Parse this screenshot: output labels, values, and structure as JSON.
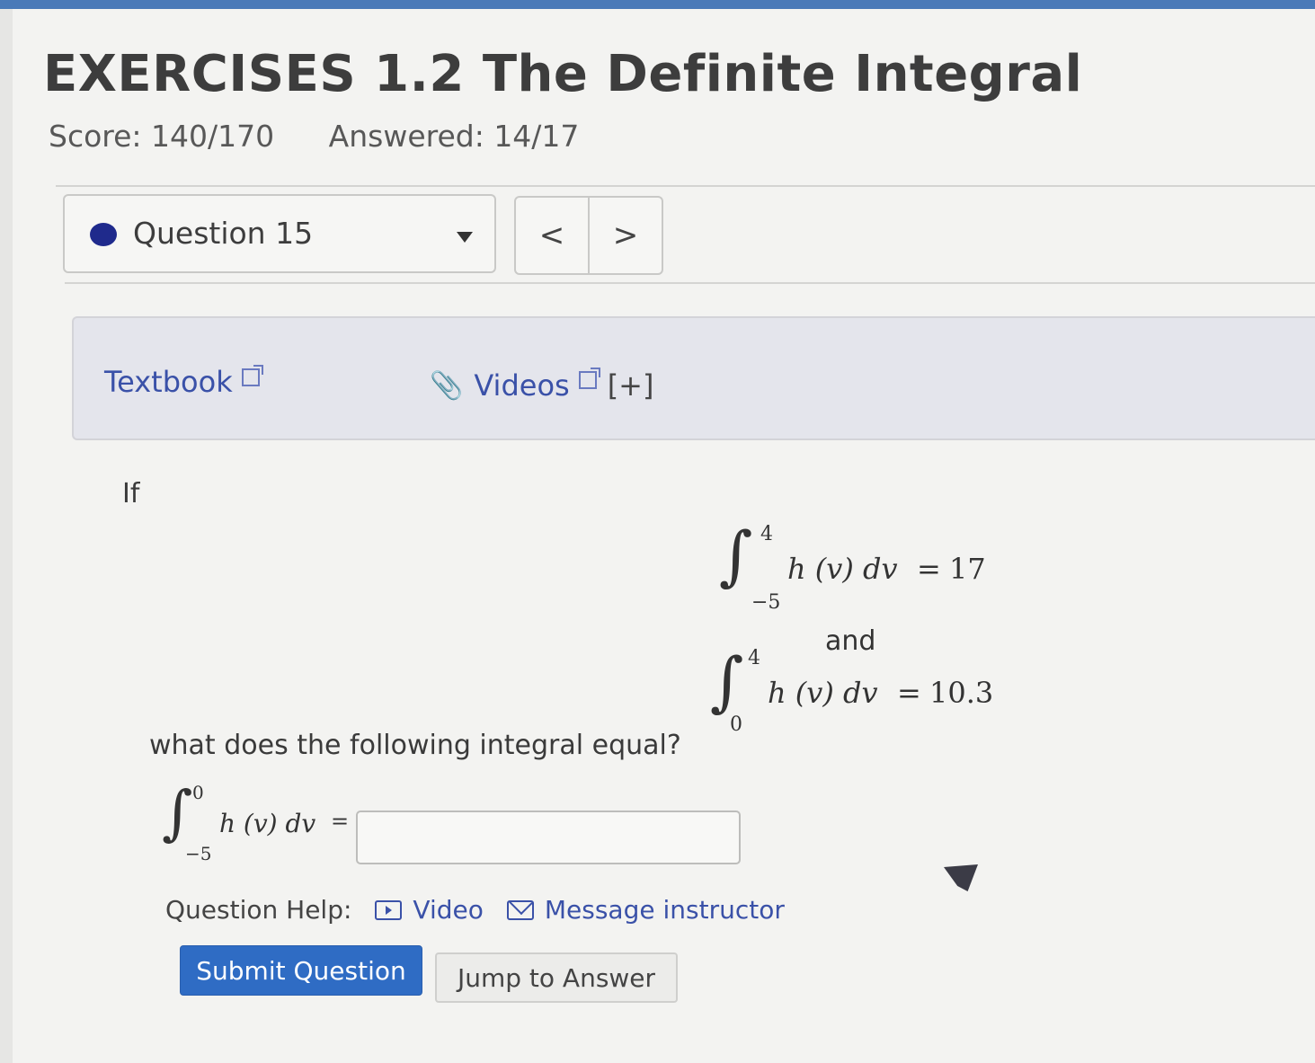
{
  "header": {
    "title": "EXERCISES 1.2 The Definite Integral",
    "score": "Score: 140/170",
    "answered": "Answered: 14/17"
  },
  "question_nav": {
    "selected": "Question 15",
    "prev_label": "<",
    "next_label": ">",
    "status_color": "#1f2a8c"
  },
  "resources": {
    "textbook_label": "Textbook",
    "videos_label": "Videos",
    "expand_label": "[+]"
  },
  "problem": {
    "intro": "If",
    "given1": {
      "integral": "∫",
      "upper": "4",
      "lower": "−5",
      "integrand": "h (v) dv",
      "equals": "=",
      "value": "17"
    },
    "connector": "and",
    "given2": {
      "integral": "∫",
      "upper": "4",
      "lower": "0",
      "integrand": "h (v) dv",
      "equals": "=",
      "value": "10.3"
    },
    "ask": "what does the following integral equal?",
    "target": {
      "integral": "∫",
      "upper": "0",
      "lower": "−5",
      "integrand": "h (v) dv",
      "equals": "="
    },
    "answer_value": ""
  },
  "help": {
    "label": "Question Help:",
    "video_label": "Video",
    "message_label": "Message instructor"
  },
  "actions": {
    "submit_label": "Submit Question",
    "jump_label": "Jump to Answer"
  },
  "colors": {
    "link": "#3a51a8",
    "submit_bg": "#2f6cc4"
  }
}
